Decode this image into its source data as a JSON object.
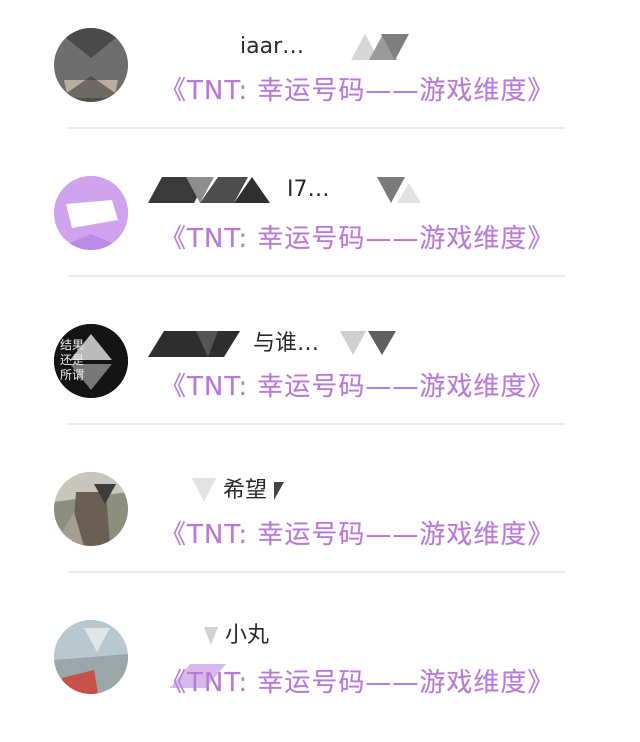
{
  "conversations": [
    {
      "name": "iaar…",
      "message": "《TNT: 幸运号码——游戏维度》"
    },
    {
      "name": "I7…",
      "message": "《TNT: 幸运号码——游戏维度》"
    },
    {
      "name": "与谁…",
      "message": "《TNT: 幸运号码——游戏维度》",
      "avatar_text": "结果 还是 所谓"
    },
    {
      "name": "希望",
      "message": "《TNT: 幸运号码——游戏维度》"
    },
    {
      "name": "小丸",
      "message": "《TNT: 幸运号码——游戏维度》"
    }
  ],
  "colors": {
    "message": "#b77ad6",
    "divider": "#ececec"
  }
}
